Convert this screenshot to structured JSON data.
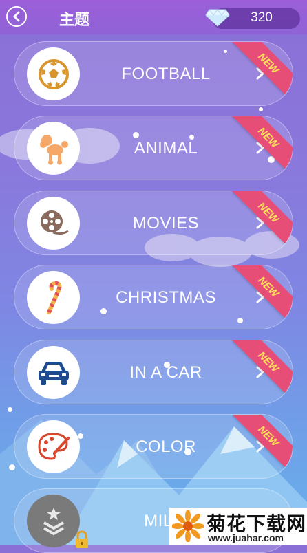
{
  "header": {
    "title": "主题",
    "gem_count": "320"
  },
  "categories": [
    {
      "label": "FOOTBALL",
      "badge": "NEW",
      "icon": "football-icon"
    },
    {
      "label": "ANIMAL",
      "badge": "NEW",
      "icon": "poodle-icon"
    },
    {
      "label": "MOVIES",
      "badge": "NEW",
      "icon": "film-reel-icon"
    },
    {
      "label": "CHRISTMAS",
      "badge": "NEW",
      "icon": "candy-cane-icon"
    },
    {
      "label": "IN A CAR",
      "badge": "NEW",
      "icon": "car-icon"
    },
    {
      "label": "COLOR",
      "badge": "NEW",
      "icon": "palette-icon"
    },
    {
      "label": "MILIT",
      "badge": "",
      "icon": "military-rank-icon",
      "locked": true
    }
  ],
  "watermark": {
    "title": "菊花下载网",
    "url": "www.juahar.com"
  },
  "colors": {
    "accent": "#9c5fd9",
    "ribbon": "#e64e78",
    "ribbon_text": "#ffe15a",
    "football": "#d9952e",
    "animal": "#f6a869",
    "car": "#1e4a8e",
    "palette": "#d6472c"
  }
}
